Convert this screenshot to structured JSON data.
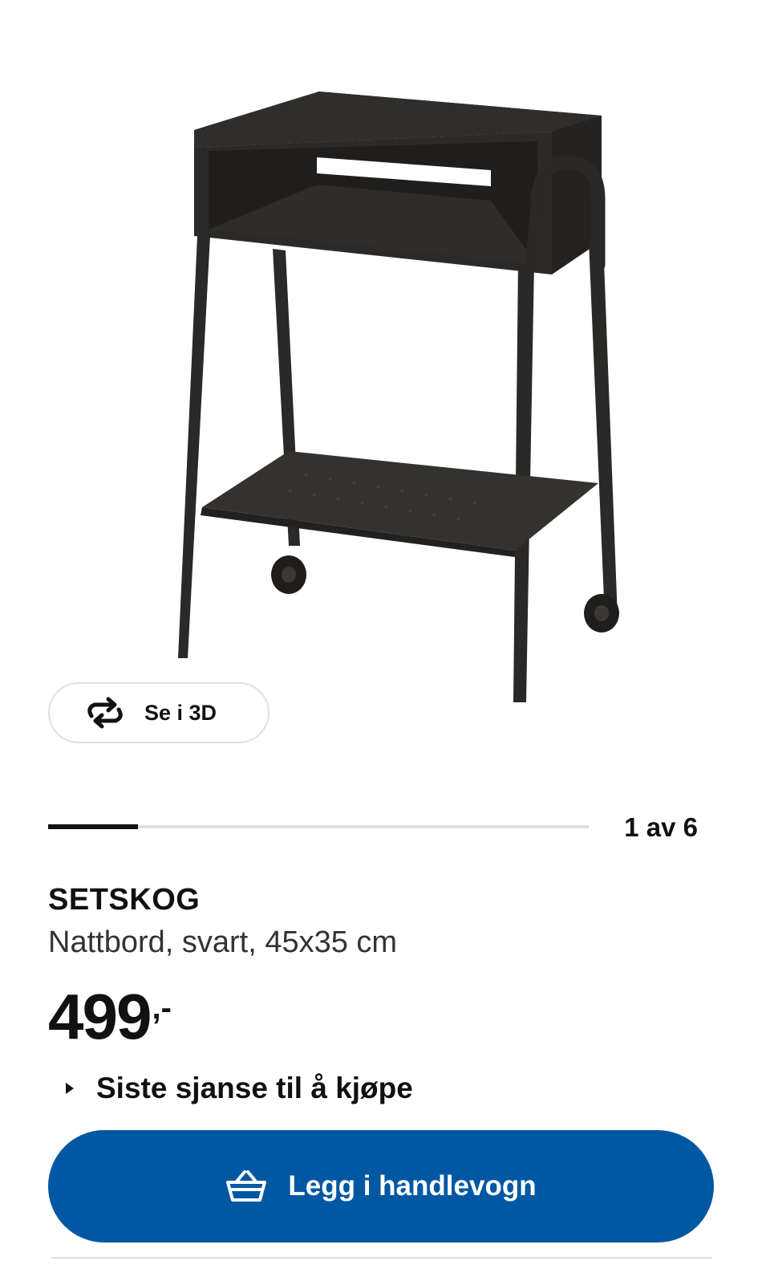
{
  "product_image": {
    "alt": "SETSKOG nattbord",
    "icon": "bedside-table-image"
  },
  "view_3d": {
    "label": "Se i 3D",
    "icon": "rotate-3d-icon"
  },
  "carousel": {
    "counter": "1 av 6",
    "current": 1,
    "total": 6
  },
  "product": {
    "name": "SETSKOG",
    "description": "Nattbord, svart, 45x35 cm",
    "price_amount": "499",
    "price_suffix": ",-",
    "availability_note": "Siste sjanse til å kjøpe"
  },
  "cart_button": {
    "label": "Legg i handlevogn",
    "icon": "basket-icon"
  },
  "colors": {
    "primary_button": "#0058a3",
    "text": "#111111",
    "track": "#dfdfdf"
  }
}
